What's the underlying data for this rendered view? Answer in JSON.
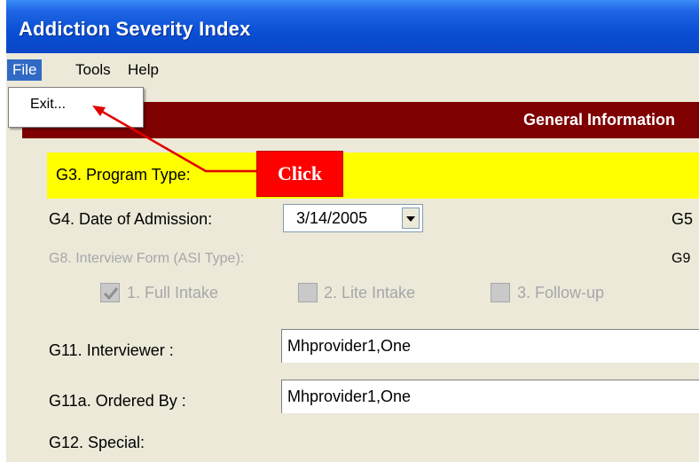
{
  "window": {
    "title": "Addiction Severity Index"
  },
  "menubar": {
    "items": [
      "File",
      "Tools",
      "Help"
    ]
  },
  "file_menu": {
    "items": [
      "Exit..."
    ]
  },
  "section": {
    "title": "General Information"
  },
  "annotation": {
    "text": "Click",
    "color": "#FF0000"
  },
  "form": {
    "g3_label": "G3. Program Type:",
    "g4_label": "G4. Date of Admission:",
    "g4_value": "3/14/2005",
    "g5_label": "G5",
    "g8_label": "G8. Interview Form   (ASI Type):",
    "g9_label": "G9",
    "options": [
      {
        "label": "1. Full Intake",
        "checked": true
      },
      {
        "label": "2. Lite Intake",
        "checked": false
      },
      {
        "label": "3. Follow-up",
        "checked": false
      }
    ],
    "g11_label": "G11. Interviewer :",
    "g11_value": "Mhprovider1,One",
    "g11a_label": "G11a. Ordered By :",
    "g11a_value": "Mhprovider1,One",
    "g12_label": "G12. Special:"
  },
  "colors": {
    "titlebar": "#0A4FD4",
    "section_header": "#7E0000",
    "highlight": "#FFFF00",
    "menu_selected": "#316AC5"
  }
}
